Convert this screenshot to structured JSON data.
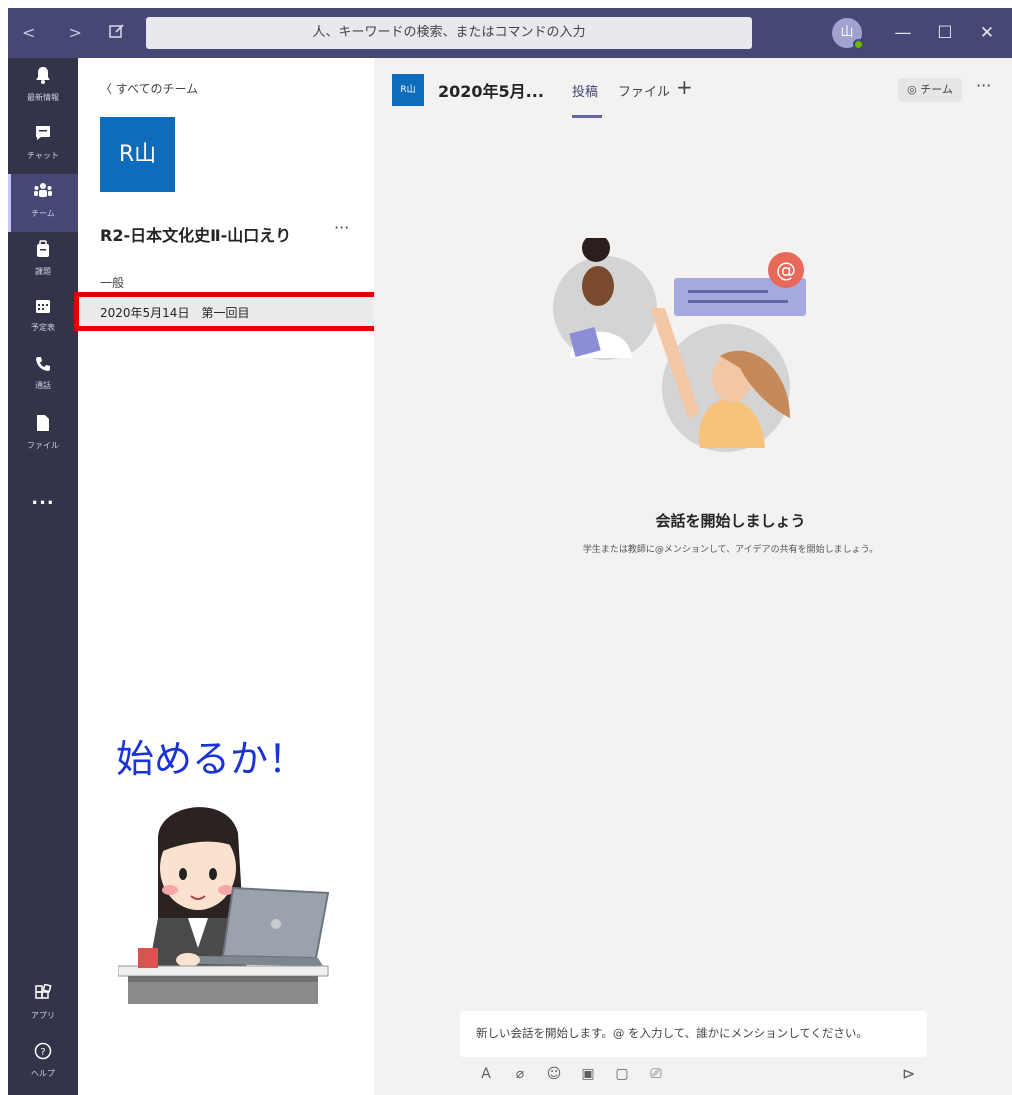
{
  "titlebar": {
    "back_arrow": "<",
    "forward_arrow": ">",
    "compose_icon": "compose-icon",
    "search_placeholder": "人、キーワードの検索、またはコマンドの入力",
    "avatar_initial": "山",
    "minimize": "—",
    "maximize": "☐",
    "close": "✕"
  },
  "rail": {
    "items": [
      {
        "icon": "bell-icon",
        "glyph": "🔔",
        "label": "最新情報"
      },
      {
        "icon": "chat-icon",
        "glyph": "💬",
        "label": "チャット"
      },
      {
        "icon": "teams-icon",
        "glyph": "👥",
        "label": "チーム"
      },
      {
        "icon": "assignments-icon",
        "glyph": "🎒",
        "label": "課題"
      },
      {
        "icon": "calendar-icon",
        "glyph": "📅",
        "label": "予定表"
      },
      {
        "icon": "phone-icon",
        "glyph": "📞",
        "label": "通話"
      },
      {
        "icon": "file-icon",
        "glyph": "📄",
        "label": "ファイル"
      }
    ],
    "more": "...",
    "apps_label": "アプリ",
    "help_label": "ヘルプ"
  },
  "teampane": {
    "back_link": "〈  すべてのチーム",
    "tile_text": "R山",
    "team_name": "R2-日本文化史Ⅱ-山口えり",
    "team_more": "···",
    "general": "一般",
    "channel": "2020年5月14日　第一回目",
    "overlay_text": "始めるか！"
  },
  "main": {
    "header_tile": "R山",
    "title": "2020年5月...",
    "tab_posts": "投稿",
    "tab_files": "ファイル",
    "tab_add": "+",
    "team_button": "◎ チーム",
    "more": "···",
    "empty_title": "会話を開始しましょう",
    "empty_subtitle": "学生または教師に@メンションして、アイデアの共有を開始しましょう。",
    "composer_placeholder": "新しい会話を開始します。@ を入力して、誰かにメンションしてください。",
    "send": "⊳"
  },
  "colors": {
    "titlebar": "#464775",
    "rail": "#33344a",
    "accent": "#6264a7",
    "tile": "#0f6cbd",
    "highlight": "#e00000",
    "overlay": "#1a33d6"
  }
}
